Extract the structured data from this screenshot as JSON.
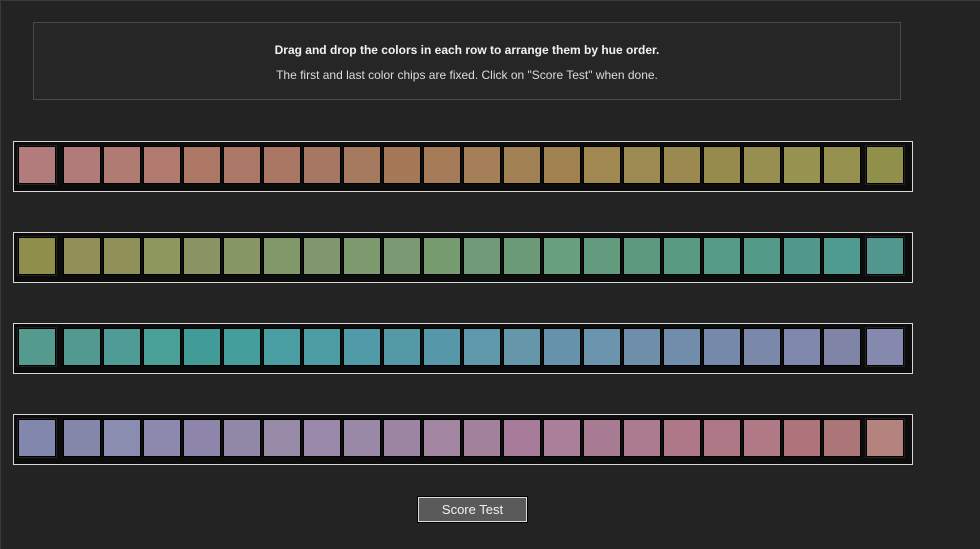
{
  "instructions": {
    "title": "Drag and drop the colors in each row to arrange them by hue order.",
    "subtitle": "The first and last color chips are fixed. Click on \"Score Test\" when done."
  },
  "rows": [
    {
      "chips": [
        "#b27b7c",
        "#b17b7a",
        "#af7b73",
        "#b07a6f",
        "#ad7766",
        "#ab7868",
        "#a97763",
        "#a67762",
        "#a67a5e",
        "#a57958",
        "#a67b57",
        "#a47f58",
        "#a18053",
        "#a08250",
        "#a08851",
        "#9b8a51",
        "#9a8a50",
        "#968a4d",
        "#968f50",
        "#979452",
        "#959250",
        "#90904b"
      ]
    },
    {
      "chips": [
        "#908e4b",
        "#918f56",
        "#8e9058",
        "#8d975e",
        "#8a9462",
        "#889766",
        "#81996a",
        "#80966c",
        "#7e9a6f",
        "#7b9a73",
        "#759b6e",
        "#6f9978",
        "#6a9a78",
        "#689f7d",
        "#629b7e",
        "#5c997f",
        "#599b82",
        "#569b88",
        "#549a89",
        "#52998d",
        "#4e9b8f",
        "#51968f"
      ]
    },
    {
      "chips": [
        "#549a8e",
        "#52998f",
        "#4f9c96",
        "#49a097",
        "#419b96",
        "#449e9c",
        "#489ea0",
        "#4b9ca3",
        "#509ba7",
        "#5399a6",
        "#5698a9",
        "#5f98ab",
        "#6596aa",
        "#6792ac",
        "#6b94ae",
        "#6e8eaa",
        "#728cab",
        "#7689ab",
        "#7a88a9",
        "#7e88ad",
        "#8085a7",
        "#8589ad"
      ]
    },
    {
      "chips": [
        "#8287ad",
        "#8486aa",
        "#8a8cb0",
        "#8d88ad",
        "#8e86ab",
        "#9188a7",
        "#978ba8",
        "#9a89a9",
        "#9a89a6",
        "#9b85a2",
        "#a386a1",
        "#a2829a",
        "#a67c9a",
        "#aa7f9a",
        "#a97b93",
        "#ac7b8f",
        "#ae7888",
        "#ad7786",
        "#b17985",
        "#af737c",
        "#ac7578",
        "#b4837e"
      ]
    }
  ],
  "score_button": {
    "label": "Score Test"
  }
}
